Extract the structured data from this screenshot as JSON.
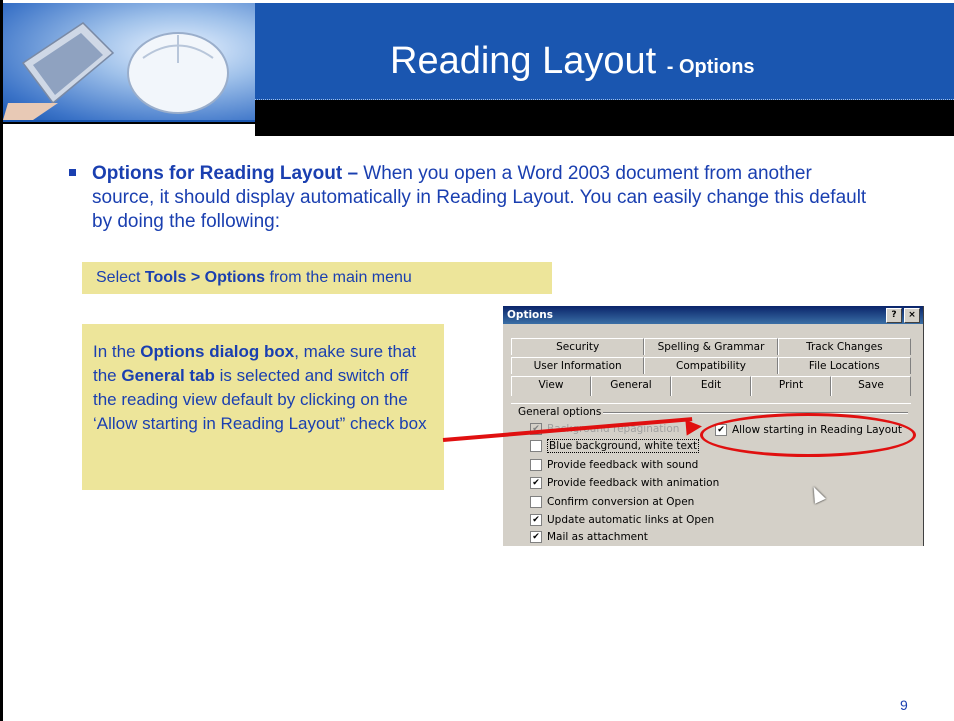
{
  "header": {
    "title": "Reading Layout",
    "title_suffix": "- Options"
  },
  "bullet": {
    "lead": "Options for Reading Layout –",
    "text": "When you open a Word 2003 document from another source, it should display automatically in Reading Layout. You can easily change this default by doing the following:"
  },
  "note1": {
    "pre": "Select",
    "bold": "Tools > Options",
    "post": "from the main menu"
  },
  "note2": {
    "p1": "In the",
    "b1": "Options dialog box",
    "p2": ", make sure that the",
    "b2": "General tab",
    "p3": "is selected and switch off the reading view default by clicking on the ‘Allow starting in Reading Layout” check box"
  },
  "dialog": {
    "title": "Options",
    "help_btn": "?",
    "close_btn": "×",
    "tabs_row1": [
      "Security",
      "Spelling & Grammar",
      "Track Changes"
    ],
    "tabs_row2": [
      "User Information",
      "Compatibility",
      "File Locations"
    ],
    "tabs_row3": [
      "View",
      "General",
      "Edit",
      "Print",
      "Save"
    ],
    "group_label": "General options",
    "options": [
      {
        "label": "Background repagination",
        "checked": true,
        "disabled": true
      },
      {
        "label": "Blue background, white text",
        "checked": false,
        "disabled": false
      },
      {
        "label": "Provide feedback with sound",
        "checked": false,
        "disabled": false
      },
      {
        "label": "Provide feedback with animation",
        "checked": true,
        "disabled": false
      },
      {
        "label": "Confirm conversion at Open",
        "checked": false,
        "disabled": false
      },
      {
        "label": "Update automatic links at Open",
        "checked": true,
        "disabled": false
      },
      {
        "label": "Mail as attachment",
        "checked": true,
        "disabled": false
      }
    ],
    "highlight_option": {
      "label": "Allow starting in Reading Layout",
      "checked": true
    }
  },
  "colors": {
    "header_blue": "#1a56b0",
    "text_blue": "#1a3fb0",
    "note_bg": "#ede59a",
    "annotation_red": "#e01010"
  },
  "page_number": "9"
}
